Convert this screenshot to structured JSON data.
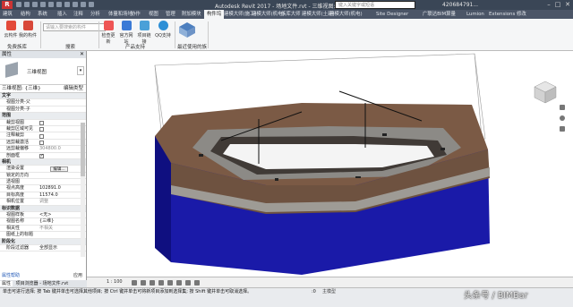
{
  "titlebar": {
    "logo": "R",
    "title": "Autodesk Revit 2017 - 场地文件.rvt - 三维视图: {三维}",
    "search_placeholder": "键入关键字或短语",
    "user": "420684791..."
  },
  "tabs": [
    "建筑",
    "结构",
    "系统",
    "插入",
    "注释",
    "分析",
    "体量和场地",
    "协作",
    "视图",
    "管理",
    "附加模块",
    "构件坞",
    "建模大师(施工)",
    "建模大师(机电)",
    "族库大师",
    "建模大师(土建)",
    "建模大师(机电)",
    "Site Designer",
    "广联达BIM算量",
    "Lumion",
    "Extensions",
    "修改"
  ],
  "ribbon": {
    "buttons": [
      "云构件",
      "我的构件",
      "检查更新",
      "官方网站",
      "项目链接",
      "QQ支持"
    ],
    "search_placeholder": "请输入要搜索的构件",
    "groups": [
      "免费族库",
      "搜索",
      "产品支持",
      "最近使用的族"
    ]
  },
  "properties": {
    "panel_title": "属性",
    "close": "✕",
    "type_name": "三维视图",
    "selector": "三维视图: {三维}",
    "edit_type": "编辑类型",
    "rows": [
      {
        "group": "文字"
      },
      {
        "k": "视图分类-父",
        "v": ""
      },
      {
        "k": "视图分类-子",
        "v": ""
      },
      {
        "group": "范围"
      },
      {
        "k": "裁剪视图",
        "cb": false
      },
      {
        "k": "裁剪区域可见",
        "cb": false
      },
      {
        "k": "注释裁剪",
        "cb": false
      },
      {
        "k": "远剪裁激活",
        "cb": false
      },
      {
        "k": "远剪裁偏移",
        "v": "304800.0",
        "dim": true
      },
      {
        "k": "剖面框",
        "cb": true
      },
      {
        "group": "相机"
      },
      {
        "k": "渲染设置",
        "btn": "编辑..."
      },
      {
        "k": "锁定的方向",
        "v": "",
        "dim": true
      },
      {
        "k": "透视图",
        "v": "",
        "dim": true
      },
      {
        "k": "视点高度",
        "v": "102891.0"
      },
      {
        "k": "目标高度",
        "v": "11574.0"
      },
      {
        "k": "相机位置",
        "v": "调整",
        "dim": true
      },
      {
        "group": "标识数据"
      },
      {
        "k": "视图样板",
        "v": "<无>"
      },
      {
        "k": "视图名称",
        "v": "{三维}"
      },
      {
        "k": "相关性",
        "v": "不相关",
        "dim": true
      },
      {
        "k": "图纸上的标题",
        "v": ""
      },
      {
        "group": "阶段化"
      },
      {
        "k": "阶段过滤器",
        "v": "全部显示"
      }
    ],
    "help_link": "属性帮助",
    "apply": "应用"
  },
  "browser_tabs": [
    "属性",
    "项目浏览器 - 场地文件.rvt"
  ],
  "view_control": {
    "scale": "1 : 100"
  },
  "status": {
    "message": "单击可进行选择; 按 Tab 键并单击可选择其他项目; 按 Ctrl 键并单击可将新项目添加到选择集; 按 Shift 键并单击可取消选择。",
    "zero": ":0",
    "model": "主模型"
  },
  "watermark": "头条号 / BIMBar",
  "colors": {
    "title_bg": "#3a4656",
    "ribbon_bg": "#f5f6f7",
    "ground": "#7b5a45",
    "water": "#1a1aa8"
  }
}
